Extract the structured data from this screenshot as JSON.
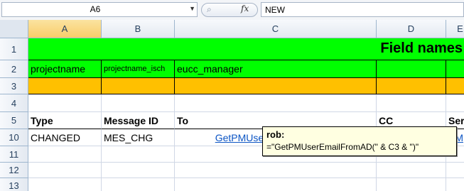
{
  "formula_bar": {
    "name_box": "A6",
    "search_icon": "magnifier-icon",
    "fx_label": "fx",
    "value": "NEW"
  },
  "columns": [
    "A",
    "B",
    "C",
    "D",
    "E"
  ],
  "rows": [
    "1",
    "2",
    "3",
    "4",
    "5",
    "10",
    "11",
    "12",
    "13"
  ],
  "cells": {
    "title": "Field names",
    "A2": "projectname",
    "B2": "projectname_isch",
    "C2": "eucc_manager",
    "A5": "Type",
    "B5": "Message ID",
    "C5": "To",
    "D5": "CC",
    "E5": "Ser",
    "A10": "CHANGED",
    "B10": "MES_CHG",
    "C10": "GetPMUserEmailFromAD()",
    "E10": "PM"
  },
  "comment": {
    "author": "rob:",
    "text": "=\"GetPMUserEmailFromAD(\" & C3 & \")\""
  },
  "colors": {
    "header_green": "#00ff00",
    "row3_orange": "#ffc000",
    "link_blue": "#0b54c4",
    "comment_bg": "#ffffe1"
  }
}
